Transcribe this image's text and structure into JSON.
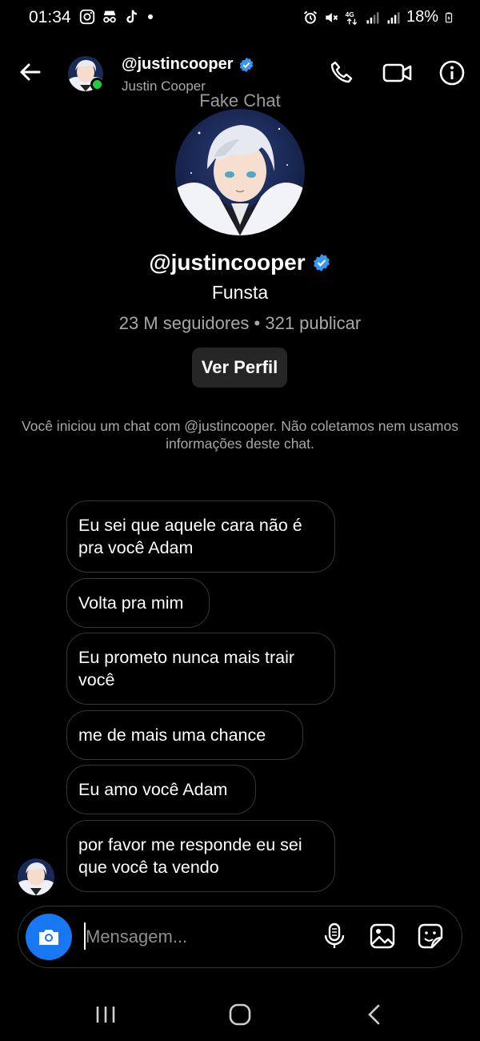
{
  "status": {
    "time": "01:34",
    "battery": "18%",
    "network": "4G",
    "left_icons": [
      "instagram-icon",
      "incognito-icon",
      "tiktok-icon",
      "dot-icon"
    ],
    "right_icons": [
      "alarm-icon",
      "mute-icon",
      "signal-icon",
      "signal-icon",
      "battery-icon"
    ]
  },
  "header": {
    "username": "@justincooper",
    "display_name": "Justin Cooper",
    "verified": true,
    "online": true
  },
  "watermark": "Fake Chat",
  "profile": {
    "username": "@justincooper",
    "bio": "Funsta",
    "stats": "23 M seguidores • 321 publicar",
    "view_button": "Ver Perfil"
  },
  "notice": "Você iniciou um chat com @justincooper. Não coletamos nem usamos informações deste chat.",
  "messages": [
    {
      "text": "Eu sei que aquele cara não é pra você Adam"
    },
    {
      "text": "Volta pra mim"
    },
    {
      "text": "Eu prometo nunca mais trair você"
    },
    {
      "text": "me de mais uma chance"
    },
    {
      "text": "Eu amo você Adam"
    },
    {
      "text": "por favor me responde eu sei que você ta vendo"
    }
  ],
  "composer": {
    "placeholder": "Mensagem..."
  },
  "colors": {
    "accent": "#1877f2",
    "verified": "#3897f0",
    "online": "#27c93f",
    "background": "#000000",
    "bubble_border": "#363636"
  }
}
